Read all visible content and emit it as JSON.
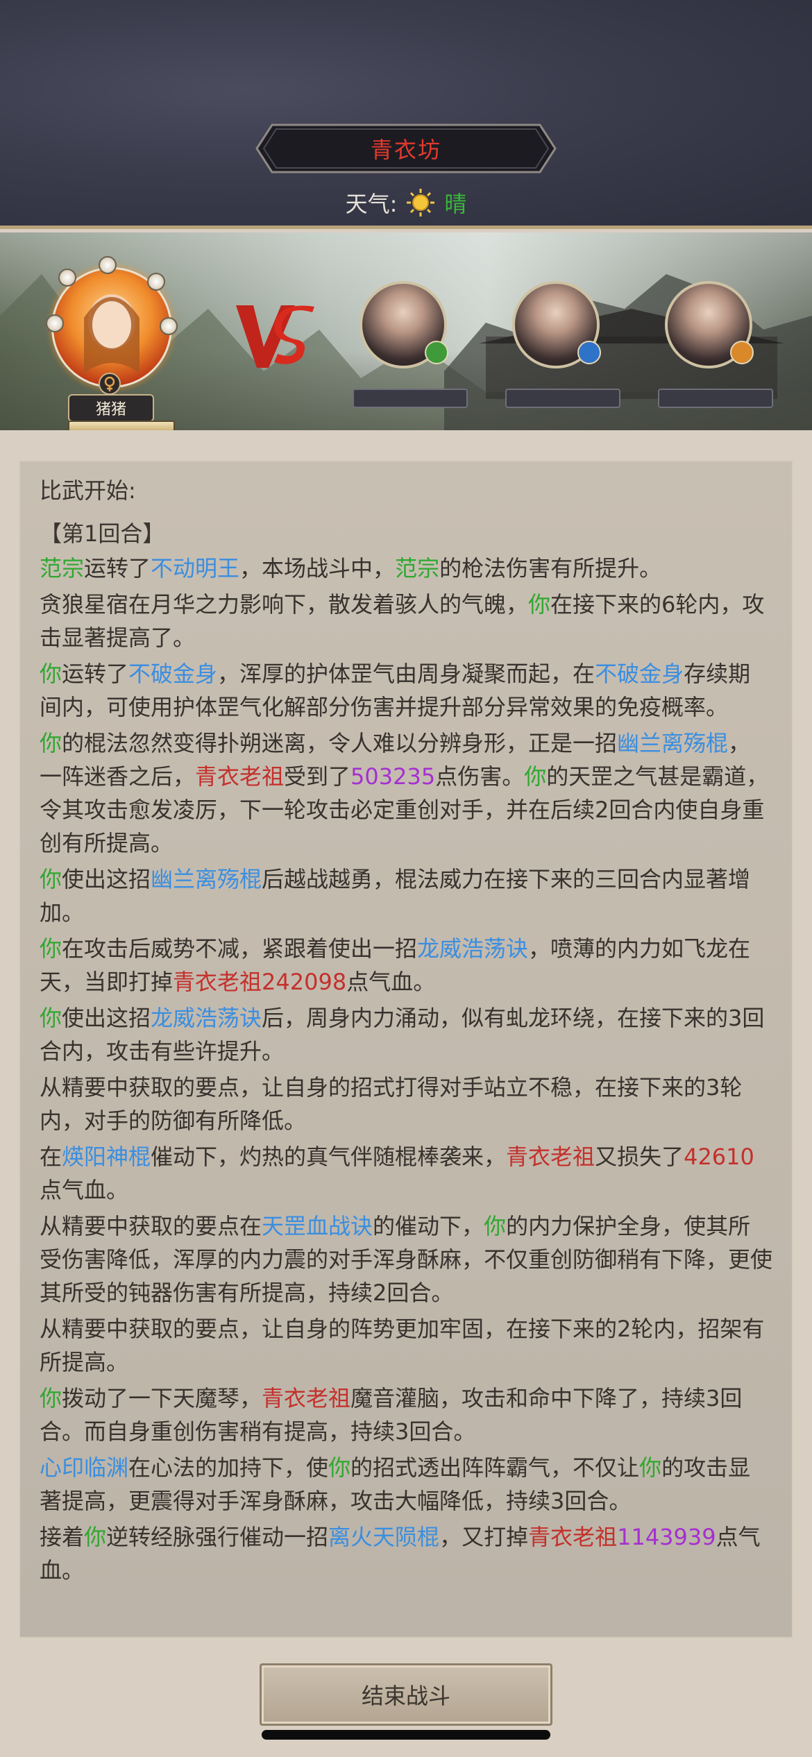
{
  "header": {
    "title": "青衣坊",
    "weather_label": "天气:",
    "weather_value": "晴",
    "weather_icon": "sun-icon"
  },
  "battle": {
    "player_name": "猪猪",
    "vs_icon": "vs-emblem-icon",
    "enemies": [
      {
        "badge_color": "#3f9a3a",
        "badge_icon": "sword-badge-icon"
      },
      {
        "badge_color": "#2f73c8",
        "badge_icon": "water-badge-icon"
      },
      {
        "badge_color": "#d9882a",
        "badge_icon": "fire-badge-icon"
      }
    ]
  },
  "log": {
    "intro": "比武开始:",
    "round_title": "【第1回合】",
    "entries": [
      [
        [
          "范宗",
          "green"
        ],
        [
          "运转了",
          ""
        ],
        [
          "不动明王",
          "blue"
        ],
        [
          "，本场战斗中，",
          ""
        ],
        [
          "范宗",
          "green"
        ],
        [
          "的枪法伤害有所提升。",
          ""
        ]
      ],
      [
        [
          "贪狼星宿在月华之力影响下，散发着骇人的气魄，",
          ""
        ],
        [
          "你",
          "green"
        ],
        [
          "在接下来的6轮内，攻击显著提高了。",
          ""
        ]
      ],
      [
        [
          "你",
          "green"
        ],
        [
          "运转了",
          ""
        ],
        [
          "不破金身",
          "blue"
        ],
        [
          "，浑厚的护体罡气由周身凝聚而起，在",
          ""
        ],
        [
          "不破金身",
          "blue"
        ],
        [
          "存续期间内，可使用护体罡气化解部分伤害并提升部分异常效果的免疫概率。",
          ""
        ]
      ],
      [
        [
          "你",
          "green"
        ],
        [
          "的棍法忽然变得扑朔迷离，令人难以分辨身形，正是一招",
          ""
        ],
        [
          "幽兰离殇棍",
          "blue"
        ],
        [
          "，一阵迷香之后，",
          ""
        ],
        [
          "青衣老祖",
          "red"
        ],
        [
          "受到了",
          ""
        ],
        [
          "503235",
          "purple"
        ],
        [
          "点伤害。",
          ""
        ],
        [
          "你",
          "green"
        ],
        [
          "的天罡之气甚是霸道，令其攻击愈发凌厉，下一轮攻击必定重创对手，并在后续2回合内使自身重创有所提高。",
          ""
        ]
      ],
      [
        [
          "你",
          "green"
        ],
        [
          "使出这招",
          ""
        ],
        [
          "幽兰离殇棍",
          "blue"
        ],
        [
          "后越战越勇，棍法威力在接下来的三回合内显著增加。",
          ""
        ]
      ],
      [
        [
          "你",
          "green"
        ],
        [
          "在攻击后威势不减，紧跟着使出一招",
          ""
        ],
        [
          "龙威浩荡诀",
          "blue"
        ],
        [
          "，喷薄的内力如飞龙在天，当即打掉",
          ""
        ],
        [
          "青衣老祖242098",
          "red"
        ],
        [
          "点气血。",
          ""
        ]
      ],
      [
        [
          "你",
          "green"
        ],
        [
          "使出这招",
          ""
        ],
        [
          "龙威浩荡诀",
          "blue"
        ],
        [
          "后，周身内力涌动，似有虬龙环绕，在接下来的3回合内，攻击有些许提升。",
          ""
        ]
      ],
      [
        [
          "从精要中获取的要点，让自身的招式打得对手站立不稳，在接下来的3轮内，对手的防御有所降低。",
          ""
        ]
      ],
      [
        [
          "在",
          ""
        ],
        [
          "煐阳神棍",
          "blue"
        ],
        [
          "催动下，灼热的真气伴随棍棒袭来，",
          ""
        ],
        [
          "青衣老祖",
          "red"
        ],
        [
          "又损失了",
          ""
        ],
        [
          "42610",
          "red"
        ],
        [
          "点气血。",
          ""
        ]
      ],
      [
        [
          "从精要中获取的要点在",
          ""
        ],
        [
          "天罡血战诀",
          "blue"
        ],
        [
          "的催动下，",
          ""
        ],
        [
          "你",
          "green"
        ],
        [
          "的内力保护全身，使其所受伤害降低，浑厚的内力震的对手浑身酥麻，不仅重创防御稍有下降，更使其所受的钝器伤害有所提高，持续2回合。",
          ""
        ]
      ],
      [
        [
          "从精要中获取的要点，让自身的阵势更加牢固，在接下来的2轮内，招架有所提高。",
          ""
        ]
      ],
      [
        [
          "你",
          "green"
        ],
        [
          "拨动了一下天魔琴，",
          ""
        ],
        [
          "青衣老祖",
          "red"
        ],
        [
          "魔音灌脑，攻击和命中下降了，持续3回合。而自身重创伤害稍有提高，持续3回合。",
          ""
        ]
      ],
      [
        [
          "心印临渊",
          "blue"
        ],
        [
          "在心法的加持下，使",
          ""
        ],
        [
          "你",
          "green"
        ],
        [
          "的招式透出阵阵霸气，不仅让",
          ""
        ],
        [
          "你",
          "green"
        ],
        [
          "的攻击显著提高，更震得对手浑身酥麻，攻击大幅降低，持续3回合。",
          ""
        ]
      ],
      [
        [
          "接着",
          ""
        ],
        [
          "你",
          "green"
        ],
        [
          "逆转经脉强行催动一招",
          ""
        ],
        [
          "离火天陨棍",
          "blue"
        ],
        [
          "，又打掉",
          ""
        ],
        [
          "青衣老祖",
          "red"
        ],
        [
          "1143939",
          "purple"
        ],
        [
          "点气血。",
          ""
        ]
      ]
    ]
  },
  "footer": {
    "end_button_label": "结束战斗"
  }
}
